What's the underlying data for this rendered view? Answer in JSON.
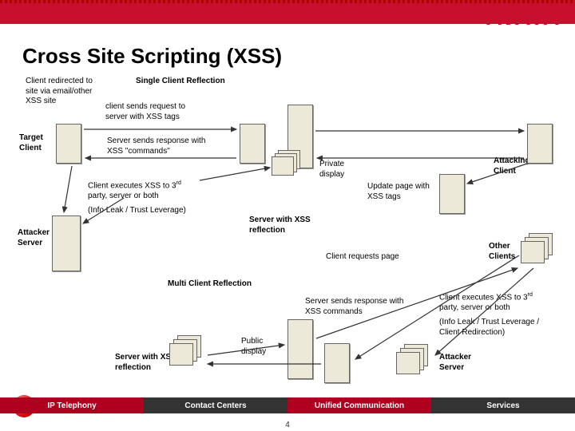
{
  "logo": "AVAYA",
  "title": "Cross Site Scripting (XSS)",
  "labels": {
    "client_redirected": "Client redirected to site via email/other XSS site",
    "single_client_reflection": "Single Client Reflection",
    "client_sends_request": "client sends request to server with XSS tags",
    "target_client": "Target Client",
    "server_sends_response_cmds": "Server sends response with XSS \"commands\"",
    "private_display": "Private display",
    "attacking_client": "Attacking Client",
    "client_executes_xss": "Client executes XSS to 3",
    "rd": "rd",
    "party_server_both": "party, server or both",
    "update_page_xss": "Update page with XSS tags",
    "info_leak": "(Info Leak / Trust Leverage)",
    "attacker_server": "Attacker Server",
    "server_with_xss_reflection": "Server with XSS reflection",
    "client_requests_page": "Client requests page",
    "other_clients": "Other Clients",
    "multi_client_reflection": "Multi Client Reflection",
    "server_sends_response2": "Server sends response with XSS commands",
    "client_executes_xss2": "Client executes XSS to 3",
    "party_server_both2": "party, server or both",
    "info_leak2": "(Info Leak / Trust Leverage / Client Redirection)",
    "public_display": "Public display",
    "attacker_server2": "Attacker Server"
  },
  "bottombar": {
    "ip": "IP Telephony",
    "cc": "Contact Centers",
    "uc": "Unified Communication",
    "sv": "Services"
  },
  "page_num": "4"
}
